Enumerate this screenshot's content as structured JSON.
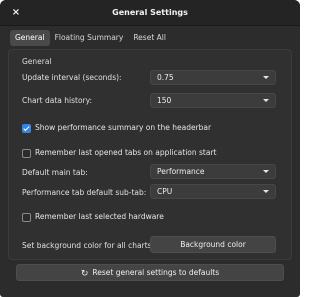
{
  "window": {
    "title": "General Settings",
    "close_glyph": "×"
  },
  "tabs": [
    {
      "label": "General",
      "active": true
    },
    {
      "label": "Floating Summary",
      "active": false
    },
    {
      "label": "Reset All",
      "active": false
    }
  ],
  "general": {
    "section_title": "General",
    "update_interval": {
      "label": "Update interval (seconds):",
      "value": "0.75"
    },
    "chart_history": {
      "label": "Chart data history:",
      "value": "150"
    },
    "show_summary": {
      "label": "Show performance summary on the headerbar",
      "checked": true
    },
    "remember_tabs": {
      "label": "Remember last opened tabs on application start",
      "checked": false
    },
    "default_main_tab": {
      "label": "Default main tab:",
      "value": "Performance"
    },
    "default_sub_tab": {
      "label": "Performance tab default sub-tab:",
      "value": "CPU"
    },
    "remember_hardware": {
      "label": "Remember last selected hardware",
      "checked": false
    },
    "bg_color": {
      "label": "Set background color for all charts:",
      "button_label": "Background color"
    }
  },
  "reset_button": {
    "label": "Reset general settings to defaults",
    "icon": "reset-icon"
  },
  "colors": {
    "accent": "#3584e4",
    "window_bg": "#2c2c2c",
    "panel_bg": "#303030"
  }
}
